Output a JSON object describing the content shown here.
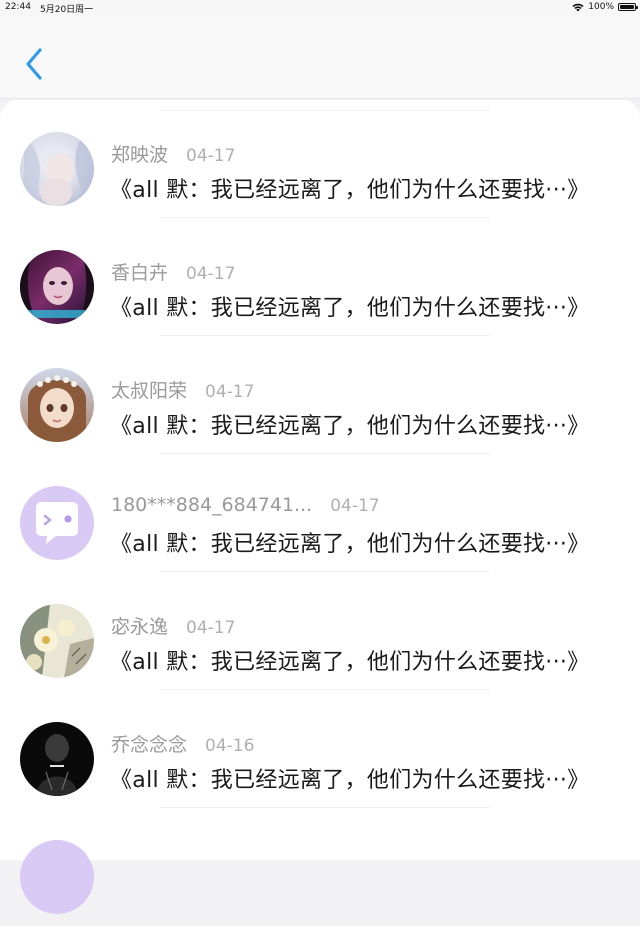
{
  "status": {
    "time": "22:44",
    "date": "5月20日周一",
    "battery": "100%"
  },
  "header": {
    "back_icon": "chevron-left-icon"
  },
  "messages": [
    {
      "name": "郑映波",
      "date": "04-17",
      "text": "《all 默：我已经远离了，他们为什么还要找···》"
    },
    {
      "name": "香白卉",
      "date": "04-17",
      "text": "《all 默：我已经远离了，他们为什么还要找···》"
    },
    {
      "name": "太叔阳荣",
      "date": "04-17",
      "text": "《all 默：我已经远离了，他们为什么还要找···》"
    },
    {
      "name": "180***884_684741...",
      "date": "04-17",
      "text": "《all 默：我已经远离了，他们为什么还要找···》"
    },
    {
      "name": "宓永逸",
      "date": "04-17",
      "text": "《all 默：我已经远离了，他们为什么还要找···》"
    },
    {
      "name": "乔念念念",
      "date": "04-16",
      "text": "《all 默：我已经远离了，他们为什么还要找···》"
    }
  ],
  "colors": {
    "accent": "#2f9be9",
    "default_avatar": "#d9c9f5"
  }
}
